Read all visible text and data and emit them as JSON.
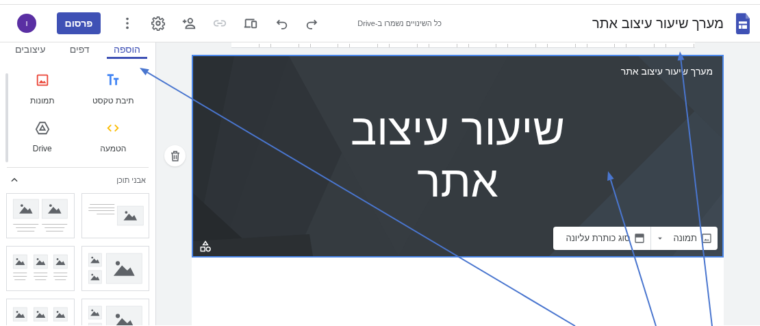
{
  "app_bar": {
    "site_title": "מערך שיעור עיצוב אתר",
    "save_status": "כל השינויים נשמרו ב-Drive",
    "toolbar": [
      {
        "kind": "redo",
        "disabled": false
      },
      {
        "kind": "undo",
        "disabled": false
      },
      {
        "kind": "preview",
        "disabled": false
      },
      {
        "kind": "link",
        "disabled": true
      },
      {
        "kind": "share",
        "disabled": false
      },
      {
        "kind": "settings",
        "disabled": false
      },
      {
        "kind": "more",
        "disabled": false
      }
    ],
    "publish_button": "פרסום",
    "avatar": "ו"
  },
  "side_panel": {
    "tabs": [
      {
        "label": "הוספה",
        "selected": true
      },
      {
        "label": "דפים",
        "selected": false
      },
      {
        "label": "עיצובים",
        "selected": false
      }
    ],
    "insert_items": [
      {
        "kind": "text",
        "label": "תיבת טקסט"
      },
      {
        "kind": "images",
        "label": "תמונות"
      },
      {
        "kind": "embed",
        "label": "הטמעה"
      },
      {
        "kind": "drive",
        "label": "Drive"
      }
    ],
    "content_blocks": {
      "title": "אבני תוכן",
      "expanded": true,
      "layouts": [
        {
          "kind": "text-image"
        },
        {
          "kind": "two-images"
        },
        {
          "kind": "image-thumbs"
        },
        {
          "kind": "three-images"
        },
        {
          "kind": "image-thumbs"
        },
        {
          "kind": "three-images"
        }
      ]
    }
  },
  "page": {
    "header": {
      "site_name": "מערך שיעור עיצוב אתר",
      "title": "שיעור עיצוב אתר",
      "image_button": "תמונה",
      "header_type_button": "סוג כותרת עליונה"
    }
  }
}
